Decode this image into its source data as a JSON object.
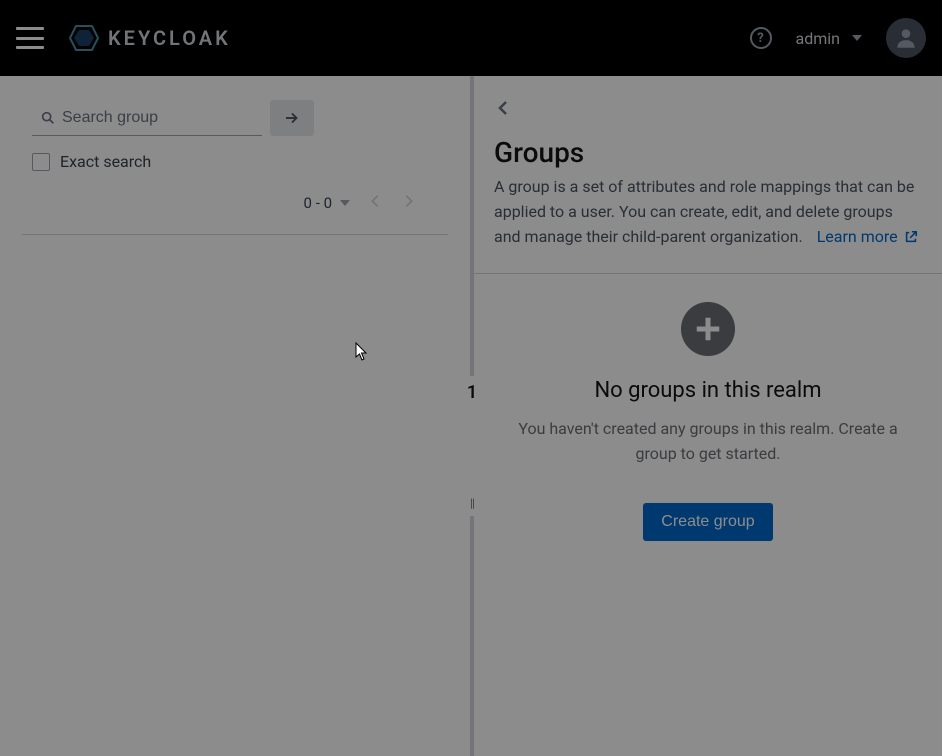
{
  "header": {
    "brand": "KEYCLOAK",
    "username": "admin"
  },
  "left": {
    "search_placeholder": "Search group",
    "exact_label": "Exact search",
    "page_range": "0 - 0"
  },
  "resizer": {
    "num": "1"
  },
  "right": {
    "title": "Groups",
    "description": "A group is a set of attributes and role mappings that can be applied to a user. You can create, edit, and delete groups and manage their child-parent organization.",
    "learn_more": "Learn more",
    "empty_title": "No groups in this realm",
    "empty_desc": "You haven't created any groups in this realm. Create a group to get started.",
    "create_label": "Create group"
  }
}
